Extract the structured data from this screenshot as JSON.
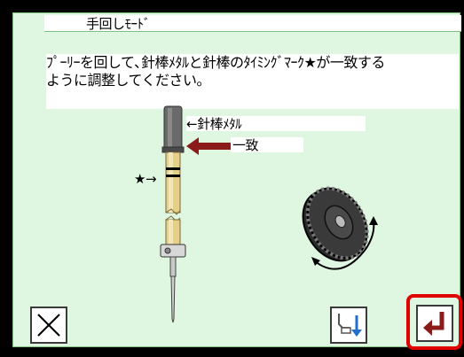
{
  "title": "手回しﾓｰﾄﾞ",
  "message": "ﾌﾟｰﾘｰを回して､針棒ﾒﾀﾙと針棒のﾀｲﾐﾝｸﾞﾏｰｸ★が一致する\nように調整してください。",
  "labels": {
    "needle_metal": "←針棒ﾒﾀﾙ",
    "match": "一致",
    "star_mark": "★→"
  },
  "icons": {
    "cancel": "close-icon",
    "switch": "needle-position-down-icon",
    "enter": "enter-return-icon"
  },
  "colors": {
    "panel_bg": "#dff6e0",
    "highlight": "#e00000",
    "arrow": "#8b1a1a",
    "needle_metal": "#555555",
    "needle_bar": "#e6d089"
  }
}
